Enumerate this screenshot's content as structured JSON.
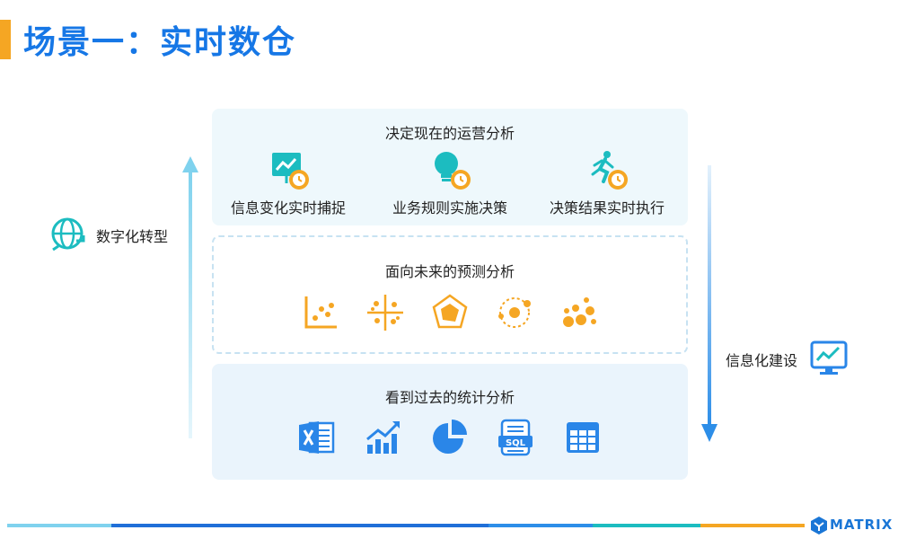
{
  "page": {
    "title": "场景一：实时数仓"
  },
  "left_label": "数字化转型",
  "right_label": "信息化建设",
  "panels": {
    "top": {
      "title": "决定现在的运营分析",
      "items": [
        {
          "label": "信息变化实时捕捉",
          "icon": "presentation-chart-clock-icon"
        },
        {
          "label": "业务规则实施决策",
          "icon": "lightbulb-clock-icon"
        },
        {
          "label": "决策结果实时执行",
          "icon": "runner-clock-icon"
        }
      ]
    },
    "middle": {
      "title": "面向未来的预测分析",
      "icons": [
        "scatter-plot-icon",
        "cluster-cross-icon",
        "radar-chart-icon",
        "orbit-icon",
        "bubbles-icon"
      ]
    },
    "bottom": {
      "title": "看到过去的统计分析",
      "icons": [
        "excel-icon",
        "bar-trend-icon",
        "pie-chart-icon",
        "sql-icon",
        "table-grid-icon"
      ]
    }
  },
  "logo": {
    "text": "MATRIX"
  },
  "colors": {
    "title": "#1677e6",
    "accent_orange": "#f5a623",
    "teal": "#1cbcc0",
    "icon_blue": "#2a86e8",
    "arrow_up": "#7fd2ee",
    "arrow_down": "#2d8ee8"
  }
}
